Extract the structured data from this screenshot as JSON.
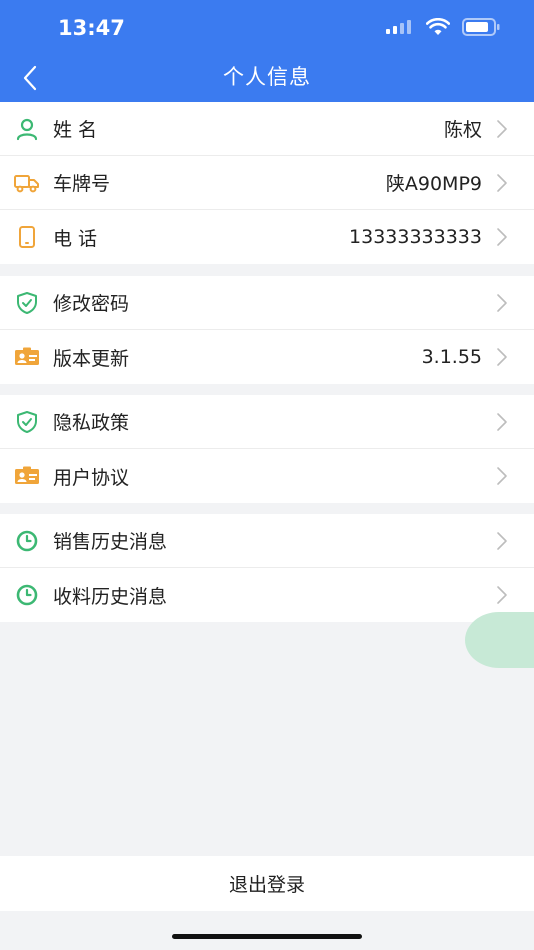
{
  "status_bar": {
    "time": "13:47"
  },
  "header": {
    "title": "个人信息"
  },
  "groups": [
    {
      "rows": [
        {
          "label": "姓 名",
          "value": "陈权",
          "icon": "person-icon"
        },
        {
          "label": "车牌号",
          "value": "陕A90MP9",
          "icon": "truck-icon"
        },
        {
          "label": "电 话",
          "value": "13333333333",
          "icon": "phone-icon"
        }
      ]
    },
    {
      "rows": [
        {
          "label": "修改密码",
          "value": "",
          "icon": "shield-check-icon"
        },
        {
          "label": "版本更新",
          "value": "3.1.55",
          "icon": "id-card-icon"
        }
      ]
    },
    {
      "rows": [
        {
          "label": "隐私政策",
          "value": "",
          "icon": "shield-check-icon"
        },
        {
          "label": "用户协议",
          "value": "",
          "icon": "id-card-icon"
        }
      ]
    },
    {
      "rows": [
        {
          "label": "销售历史消息",
          "value": "",
          "icon": "clock-icon"
        },
        {
          "label": "收料历史消息",
          "value": "",
          "icon": "clock-icon"
        }
      ]
    }
  ],
  "footer": {
    "logout_label": "退出登录"
  },
  "colors": {
    "header": "#3b7bf0",
    "green": "#3cb873",
    "orange": "#f0a53a",
    "bubble": "#c7e9d6"
  }
}
